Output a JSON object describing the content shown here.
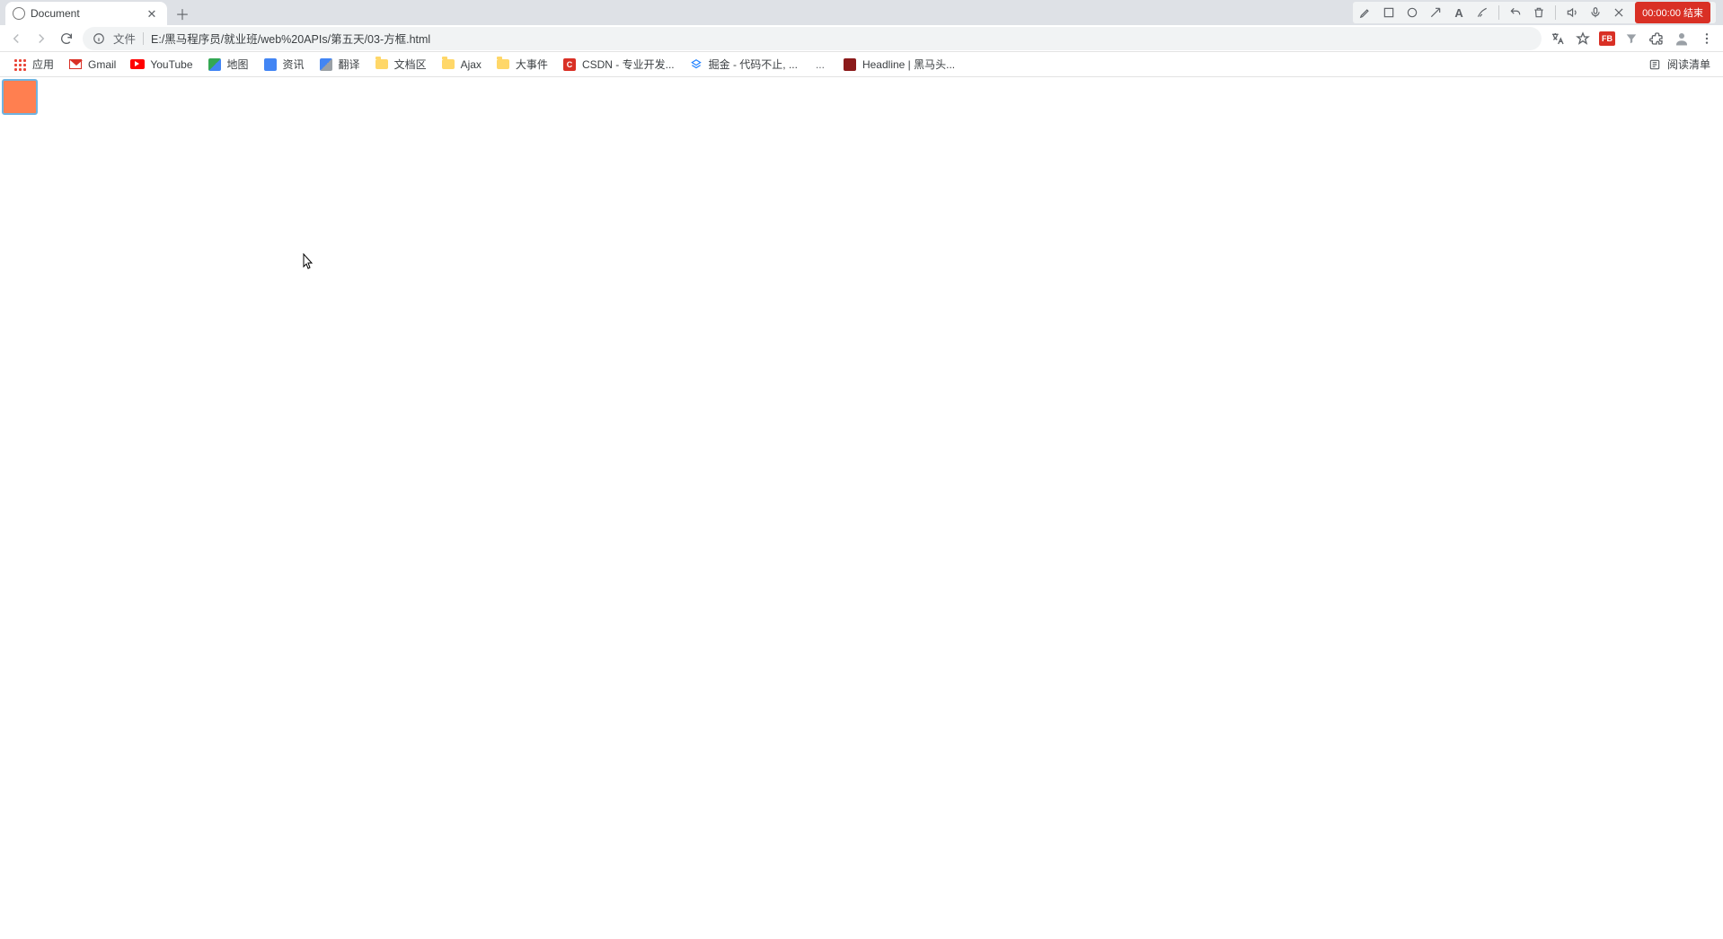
{
  "tab": {
    "title": "Document",
    "close_tooltip": "Close"
  },
  "recording_toolbar": {
    "end_button": "00:00:00 结束"
  },
  "address_bar": {
    "prefix_label": "文件",
    "url": "E:/黑马程序员/就业班/web%20APIs/第五天/03-方框.html"
  },
  "toolbar_right": {
    "translate_tooltip": "Translate",
    "star_tooltip": "Bookmark",
    "fb_badge": "FB",
    "extensions_tooltip": "Extensions",
    "profile_tooltip": "You",
    "menu_tooltip": "Customize"
  },
  "bookmarks": [
    {
      "icon": "apps",
      "label": "应用"
    },
    {
      "icon": "gmail",
      "label": "Gmail"
    },
    {
      "icon": "youtube",
      "label": "YouTube"
    },
    {
      "icon": "maps",
      "label": "地图"
    },
    {
      "icon": "news",
      "label": "资讯"
    },
    {
      "icon": "translate",
      "label": "翻译"
    },
    {
      "icon": "folder",
      "label": "文档区"
    },
    {
      "icon": "folder",
      "label": "Ajax"
    },
    {
      "icon": "folder",
      "label": "大事件"
    },
    {
      "icon": "csdn",
      "label": "CSDN - 专业开发..."
    },
    {
      "icon": "juejin",
      "label": "掘金 - 代码不止, ..."
    },
    {
      "icon": "ellipsis",
      "label": "..."
    },
    {
      "icon": "headline",
      "label": "Headline | 黑马头..."
    }
  ],
  "bookmarks_right": {
    "reading_list": "阅读清单"
  },
  "page_content": {
    "box_description": "orange square"
  }
}
